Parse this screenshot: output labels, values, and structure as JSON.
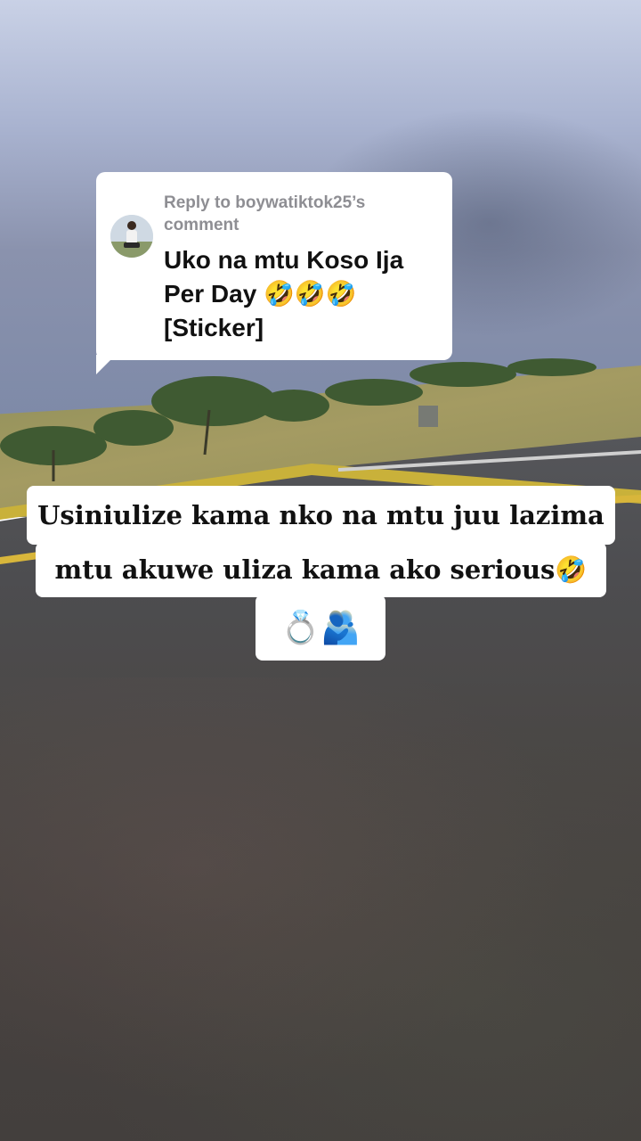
{
  "reply_card": {
    "label": "Reply to boywatiktok25’s comment",
    "text": "Uko na mtu Koso Ija Per Day 🤣🤣🤣 [Sticker]"
  },
  "caption": {
    "line1": "Usiniulize kama nko na mtu juu lazima",
    "line2": "mtu akuwe uliza kama ako serious🤣",
    "line3": "💍🫂"
  }
}
